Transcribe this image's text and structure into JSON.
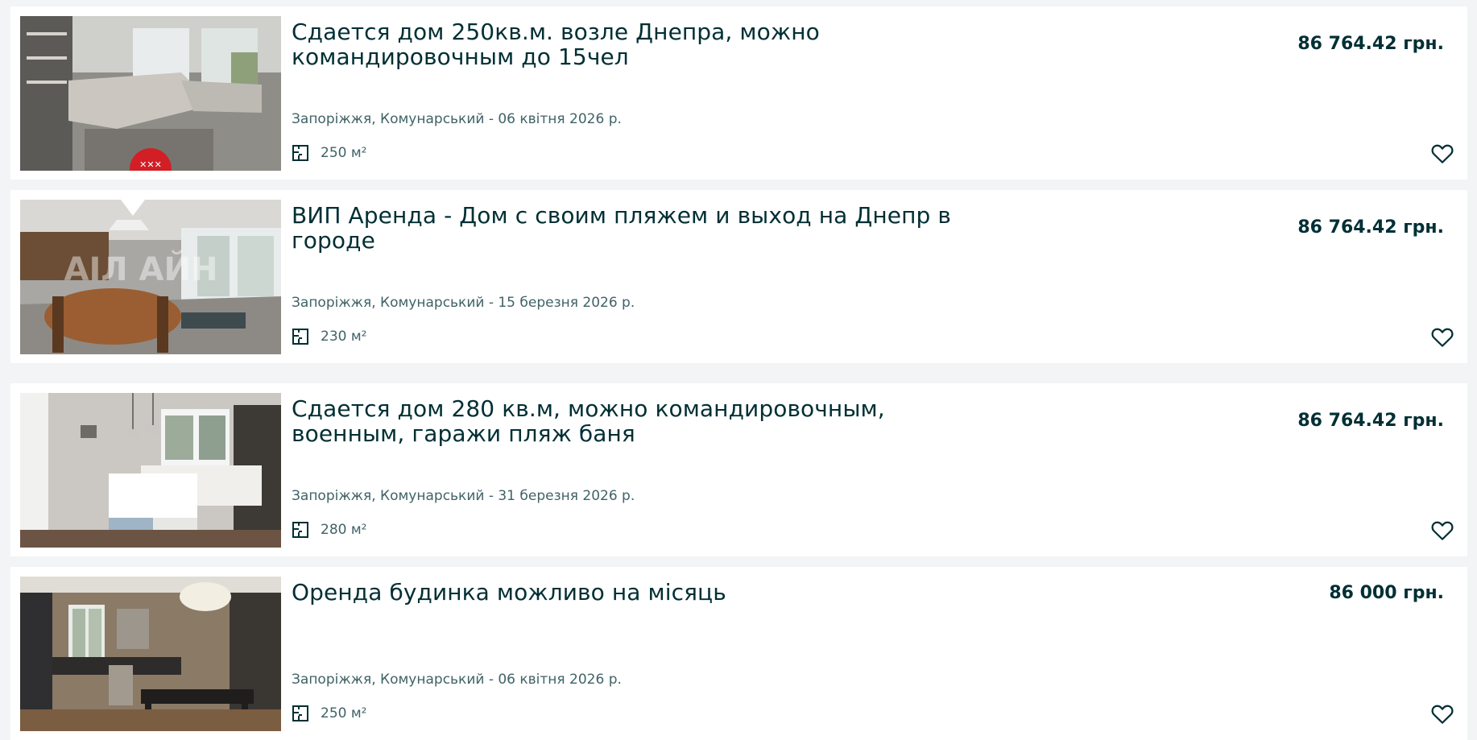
{
  "listings": [
    {
      "title": "Сдается дом 250кв.м. возле Днепра, можно командировочным до 15чел",
      "price": "86 764.42 грн.",
      "location_date": "Запоріжжя, Комунарський - 06 квітня 2026 р.",
      "area": "250 м²",
      "image": "living-room-photo"
    },
    {
      "title": "ВИП Аренда - Дом с своим пляжем и выход на Днепр в городе",
      "price": "86 764.42 грн.",
      "location_date": "Запоріжжя, Комунарський - 15 березня 2026 р.",
      "area": "230 м²",
      "image": "dining-room-photo"
    },
    {
      "title": "Сдается дом 280 кв.м, можно командировочным, военным, гаражи пляж баня",
      "price": "86 764.42 грн.",
      "location_date": "Запоріжжя, Комунарський - 31 березня 2026 р.",
      "area": "280 м²",
      "image": "kitchen-photo"
    },
    {
      "title": "Оренда будинка можливо на місяць",
      "price": "86 000 грн.",
      "location_date": "Запоріжжя, Комунарський - 06 квітня 2026 р.",
      "area": "250 м²",
      "image": "kitchen-dining-photo"
    }
  ],
  "colors": {
    "page_background": "#f2f4f5",
    "card_background": "#ffffff",
    "text_primary": "#002f34",
    "text_secondary": "#406367"
  },
  "icons": {
    "area": "floor-plan-icon",
    "favorite": "heart-outline-icon"
  }
}
